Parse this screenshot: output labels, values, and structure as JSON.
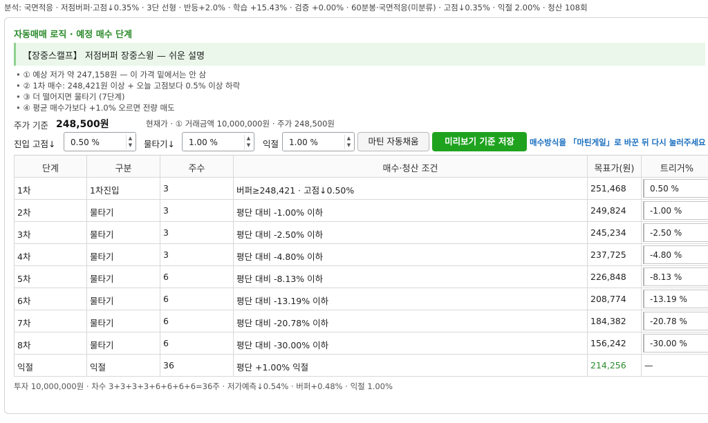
{
  "top_summary": "분석: 국면적응 · 저점버퍼·고점↓0.35% · 3단 선형 · 반등+2.0% · 학습 +15.43% · 검증 +0.00% · 60분봉·국면적응(미분류) · 고점↓0.35% · 익절 2.00% · 청산 108회",
  "panel": {
    "title": "자동매매 로직 · 예정 매수 단계",
    "explain_title": "【장중스캘프】 저점버퍼 장중스윙 — 쉬운 설명",
    "steps": [
      "① 예상 저가 약 247,158원 — 이 가격 밑에서는 안 삼",
      "② 1차 매수: 248,421원 이상 + 오늘 고점보다 0.5% 이상 하락",
      "③ 더 떨어지면 물타기 (7단계)",
      "④ 평균 매수가보다 +1.0% 오르면 전량 매도"
    ],
    "price_label": "주가 기준",
    "price_value": "248,500원",
    "price_note": "현재가 · ① 거래금액 10,000,000원 · 주가 248,500원"
  },
  "controls": {
    "entry_label": "진입 고점↓",
    "entry_value": "0.50 %",
    "water_label": "물타기↓",
    "water_value": "1.00 %",
    "take_label": "익절",
    "take_value": "1.00 %",
    "autofill_label": "마틴 자동채움",
    "save_label": "미리보기 기준 저장",
    "hint": "매수방식을 「마틴게일」로 바꾼 뒤 다시 눌러주세요"
  },
  "table": {
    "headers": [
      "단계",
      "구분",
      "주수",
      "매수·청산 조건",
      "목표가(원)",
      "트리거%"
    ],
    "rows": [
      {
        "stage": "1차",
        "kind": "1차진입",
        "qty": "3",
        "cond": "버퍼≥248,421 · 고점↓0.50%",
        "target": "251,468",
        "trigger": "0.50 %"
      },
      {
        "stage": "2차",
        "kind": "물타기",
        "qty": "3",
        "cond": "평단 대비 -1.00% 이하",
        "target": "249,824",
        "trigger": "-1.00 %"
      },
      {
        "stage": "3차",
        "kind": "물타기",
        "qty": "3",
        "cond": "평단 대비 -2.50% 이하",
        "target": "245,234",
        "trigger": "-2.50 %"
      },
      {
        "stage": "4차",
        "kind": "물타기",
        "qty": "3",
        "cond": "평단 대비 -4.80% 이하",
        "target": "237,725",
        "trigger": "-4.80 %"
      },
      {
        "stage": "5차",
        "kind": "물타기",
        "qty": "6",
        "cond": "평단 대비 -8.13% 이하",
        "target": "226,848",
        "trigger": "-8.13 %"
      },
      {
        "stage": "6차",
        "kind": "물타기",
        "qty": "6",
        "cond": "평단 대비 -13.19% 이하",
        "target": "208,774",
        "trigger": "-13.19 %"
      },
      {
        "stage": "7차",
        "kind": "물타기",
        "qty": "6",
        "cond": "평단 대비 -20.78% 이하",
        "target": "184,382",
        "trigger": "-20.78 %"
      },
      {
        "stage": "8차",
        "kind": "물타기",
        "qty": "6",
        "cond": "평단 대비 -30.00% 이하",
        "target": "156,242",
        "trigger": "-30.00 %"
      }
    ],
    "exit_row": {
      "stage": "익절",
      "kind": "익절",
      "qty": "36",
      "cond": "평단 +1.00% 익절",
      "target": "214,256",
      "trigger": "—"
    }
  },
  "footer": "투자 10,000,000원 · 차수 3+3+3+3+6+6+6+6=36주 · 저가예측↓0.54% · 버퍼+0.48% · 익절 1.00%",
  "colors": {
    "accent_green": "#1fa31f",
    "title_green": "#2a8a2a",
    "link_blue": "#1a6fbf"
  }
}
